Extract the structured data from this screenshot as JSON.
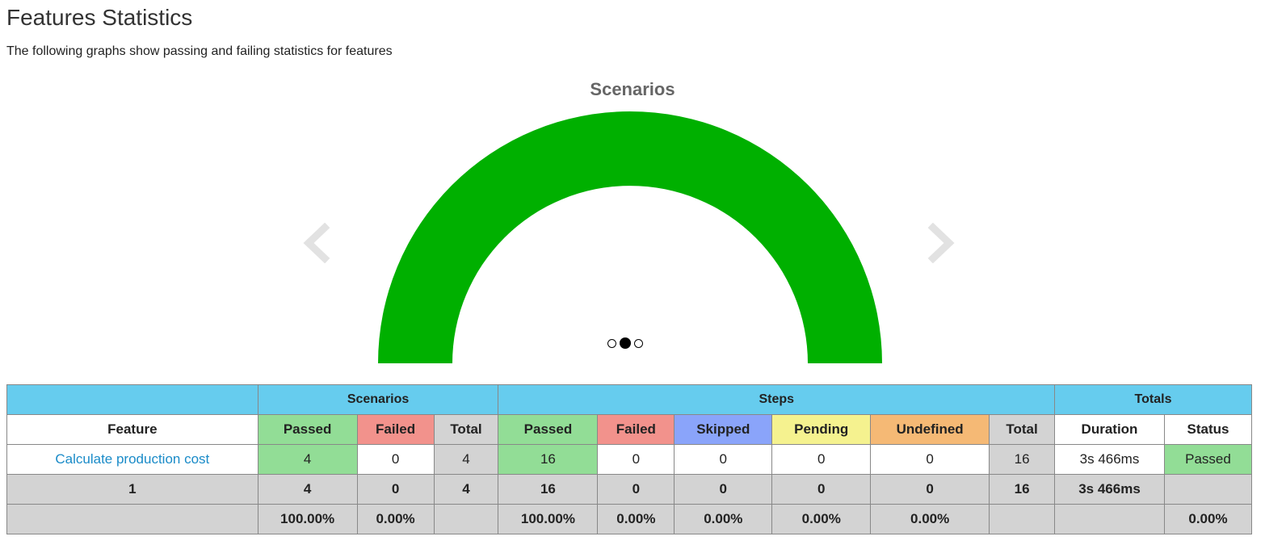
{
  "page": {
    "title": "Features Statistics",
    "subtitle": "The following graphs show passing and failing statistics for features"
  },
  "carousel": {
    "active_slide": 2,
    "slide_count": 3
  },
  "chart_data": {
    "type": "pie",
    "variant": "half-doughnut",
    "title": "Scenarios",
    "labels": [
      "Passed"
    ],
    "values": [
      4
    ],
    "colors": [
      "#00b000"
    ]
  },
  "table": {
    "groups": {
      "scenarios": "Scenarios",
      "steps": "Steps",
      "totals": "Totals"
    },
    "headers": {
      "feature": "Feature",
      "sc_passed": "Passed",
      "sc_failed": "Failed",
      "sc_total": "Total",
      "st_passed": "Passed",
      "st_failed": "Failed",
      "st_skipped": "Skipped",
      "st_pending": "Pending",
      "st_undefined": "Undefined",
      "st_total": "Total",
      "duration": "Duration",
      "status": "Status"
    },
    "row": {
      "feature": "Calculate production cost",
      "sc_passed": "4",
      "sc_failed": "0",
      "sc_total": "4",
      "st_passed": "16",
      "st_failed": "0",
      "st_skipped": "0",
      "st_pending": "0",
      "st_undefined": "0",
      "st_total": "16",
      "duration": "3s 466ms",
      "status": "Passed"
    },
    "summary": {
      "feature": "1",
      "sc_passed": "4",
      "sc_failed": "0",
      "sc_total": "4",
      "st_passed": "16",
      "st_failed": "0",
      "st_skipped": "0",
      "st_pending": "0",
      "st_undefined": "0",
      "st_total": "16",
      "duration": "3s 466ms",
      "status": ""
    },
    "percent": {
      "sc_passed": "100.00%",
      "sc_failed": "0.00%",
      "st_passed": "100.00%",
      "st_failed": "0.00%",
      "st_skipped": "0.00%",
      "st_pending": "0.00%",
      "st_undefined": "0.00%",
      "status": "0.00%"
    }
  }
}
